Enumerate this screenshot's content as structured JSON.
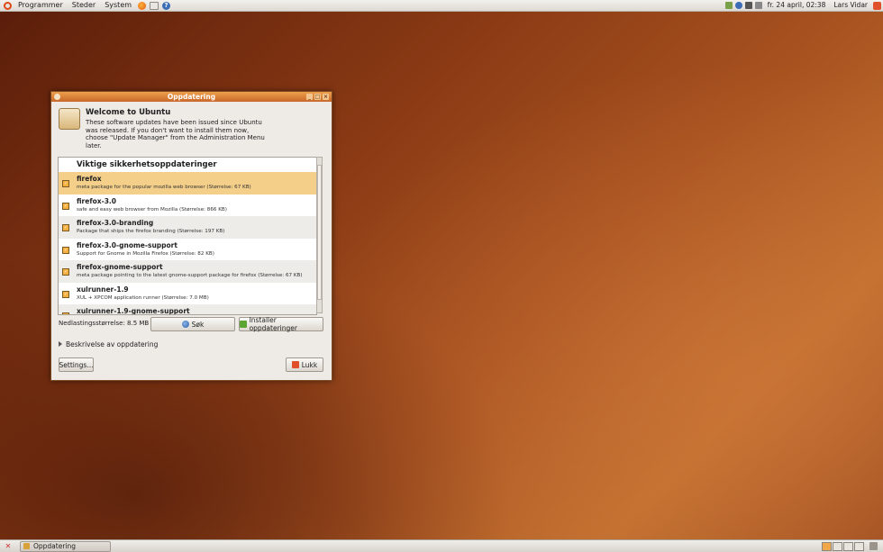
{
  "top_panel": {
    "menus": [
      "Programmer",
      "Steder",
      "System"
    ],
    "clock": "fr. 24 april, 02:38",
    "user": "Lars Vidar"
  },
  "bottom_panel": {
    "task_label": "Oppdatering"
  },
  "window": {
    "title": "Oppdatering",
    "header_title": "Welcome to Ubuntu",
    "header_text": "These software updates have been issued since Ubuntu was released. If you don't want to install them now, choose \"Update Manager\" from the Administration Menu later.",
    "list_heading": "Viktige sikkerhetsoppdateringer",
    "packages": [
      {
        "name": "firefox",
        "desc": "meta package for the popular mozilla web browser (Størrelse: 67 KB)"
      },
      {
        "name": "firefox-3.0",
        "desc": "safe and easy web browser from Mozilla (Størrelse: 866 KB)"
      },
      {
        "name": "firefox-3.0-branding",
        "desc": "Package that ships the firefox branding (Størrelse: 197 KB)"
      },
      {
        "name": "firefox-3.0-gnome-support",
        "desc": "Support for Gnome in Mozilla Firefox (Størrelse: 82 KB)"
      },
      {
        "name": "firefox-gnome-support",
        "desc": "meta package pointing to the latest gnome-support package for firefox (Størrelse: 67 KB)"
      },
      {
        "name": "xulrunner-1.9",
        "desc": "XUL + XPCOM application runner (Størrelse: 7.0 MB)"
      },
      {
        "name": "xulrunner-1.9-gnome-support",
        "desc": ""
      }
    ],
    "download_size": "Nedlastingsstørrelse: 8.5 MB",
    "search_button": "Søk",
    "install_button": "Installer oppdateringer",
    "expander_label": "Beskrivelse av oppdatering",
    "settings_button": "Settings...",
    "close_button": "Lukk"
  }
}
